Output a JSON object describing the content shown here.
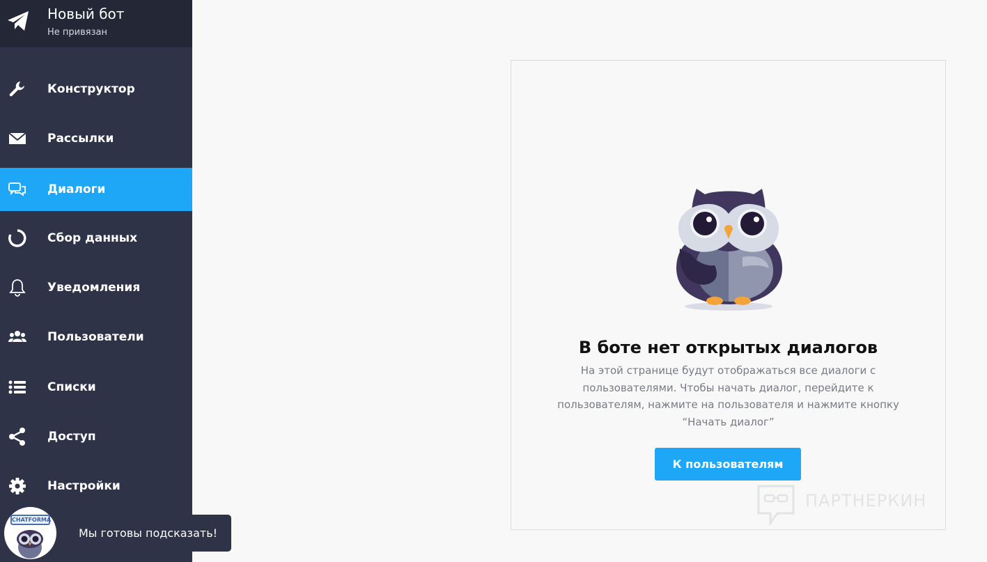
{
  "bot": {
    "title": "Новый бот",
    "status": "Не привязан"
  },
  "nav": [
    {
      "label": "Конструктор",
      "icon": "wrench-icon",
      "active": false
    },
    {
      "label": "Рассылки",
      "icon": "envelope-icon",
      "active": false
    },
    {
      "label": "Диалоги",
      "icon": "chat-bubbles-icon",
      "active": true
    },
    {
      "label": "Сбор данных",
      "icon": "circle-progress-icon",
      "active": false
    },
    {
      "label": "Уведомления",
      "icon": "bell-icon",
      "active": false
    },
    {
      "label": "Пользователи",
      "icon": "users-icon",
      "active": false
    },
    {
      "label": "Списки",
      "icon": "list-icon",
      "active": false
    },
    {
      "label": "Доступ",
      "icon": "share-icon",
      "active": false
    },
    {
      "label": "Настройки",
      "icon": "gear-icon",
      "active": false
    }
  ],
  "empty_state": {
    "title": "В боте нет открытых диалогов",
    "description": "На этой странице будут отображаться все диалоги с пользователями. Чтобы начать диалог, перейдите к пользователям, нажмите на пользователя и нажмите кнопку “Начать диалог”",
    "button_label": "К пользователям"
  },
  "chat_widget": {
    "brand_label": "CHATFORMA",
    "tooltip": "Мы готовы подсказать!"
  },
  "watermark": {
    "text": "ПАРТНЕРКИН"
  },
  "colors": {
    "sidebar_bg": "#2e3347",
    "header_bg": "#232736",
    "accent": "#1ea7f7",
    "page_bg": "#f8f8f8"
  }
}
